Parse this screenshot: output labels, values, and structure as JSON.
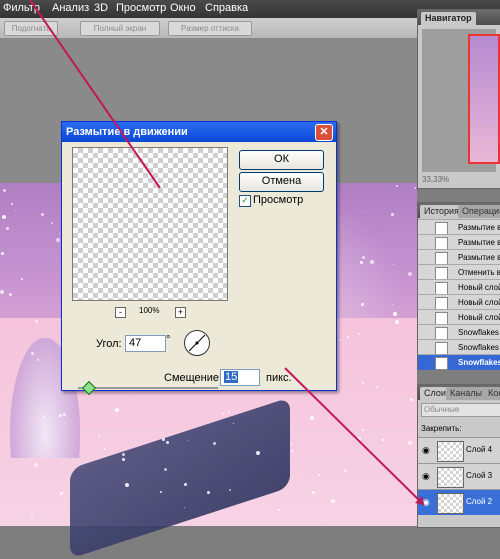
{
  "menu": [
    "Фильтр",
    "Анализ",
    "3D",
    "Просмотр",
    "Окно",
    "Справка"
  ],
  "options_bar": [
    "Подогнать",
    "Полный экран",
    "Размер оттиска"
  ],
  "dialog": {
    "title": "Размытие в движении",
    "ok_label": "ОК",
    "cancel_label": "Отмена",
    "preview_label": "Просмотр",
    "preview_checked": true,
    "zoom_minus": "-",
    "zoom_level": "100%",
    "zoom_plus": "+",
    "angle_label": "Угол:",
    "angle_value": "47",
    "degree_symbol": "°",
    "distance_label": "Смещение:",
    "distance_value": "15",
    "distance_unit": "пикс."
  },
  "navigator": {
    "tab": "Навигатор",
    "zoom": "33,33%"
  },
  "history": {
    "tabs": [
      "История",
      "Операции"
    ],
    "items": [
      {
        "label": "Размытие в",
        "selected": false
      },
      {
        "label": "Размытие в",
        "selected": false
      },
      {
        "label": "Размытие в",
        "selected": false
      },
      {
        "label": "Отменить в",
        "selected": false
      },
      {
        "label": "Новый слой",
        "selected": false
      },
      {
        "label": "Новый слой",
        "selected": false
      },
      {
        "label": "Новый слой",
        "selected": false
      },
      {
        "label": "Snowflakes",
        "selected": false
      },
      {
        "label": "Snowflakes",
        "selected": false
      },
      {
        "label": "Snowflakes",
        "selected": true
      }
    ]
  },
  "layers": {
    "tabs": [
      "Слои",
      "Каналы",
      "Конт"
    ],
    "blend_mode": "Обычные",
    "lock_label": "Закрепить:",
    "items": [
      {
        "name": "Слой 4",
        "selected": false
      },
      {
        "name": "Слой 3",
        "selected": false
      },
      {
        "name": "Слой 2",
        "selected": true
      }
    ]
  },
  "colors": {
    "arrow": "#c2185b",
    "selection": "#3568d4",
    "dialog_title": "#0a47d6"
  }
}
